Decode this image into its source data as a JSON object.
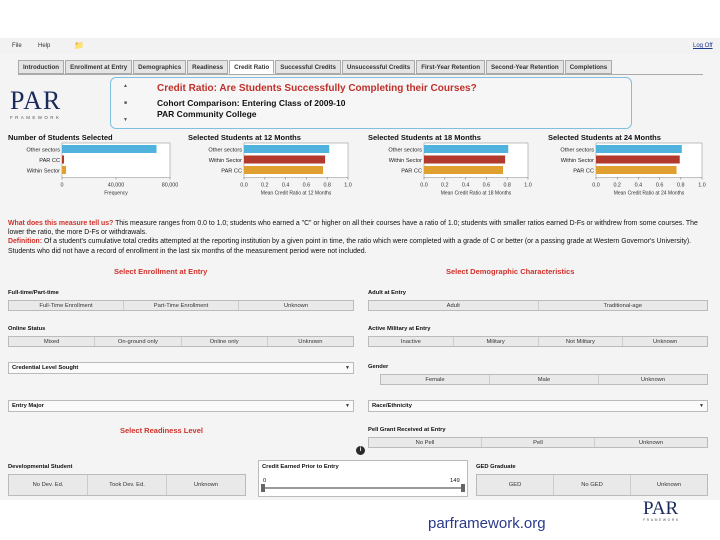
{
  "menu": {
    "file": "File",
    "help": "Help",
    "folder_icon": "folder-icon",
    "logoff": "Log Off"
  },
  "tabs": [
    {
      "label": "Introduction",
      "active": false
    },
    {
      "label": "Enrollment at Entry",
      "active": false
    },
    {
      "label": "Demographics",
      "active": false
    },
    {
      "label": "Readiness",
      "active": false
    },
    {
      "label": "Credit Ratio",
      "active": true
    },
    {
      "label": "Successful Credits",
      "active": false
    },
    {
      "label": "Unsuccessful Credits",
      "active": false
    },
    {
      "label": "First-Year Retention",
      "active": false
    },
    {
      "label": "Second-Year Retention",
      "active": false
    },
    {
      "label": "Completions",
      "active": false
    }
  ],
  "logo": {
    "text": "PAR",
    "subtext": "FRAMEWORK"
  },
  "header": {
    "title": "Credit Ratio: Are Students Successfully Completing their Courses?",
    "cohort": "Cohort Comparison: Entering Class of 2009-10",
    "institution": "PAR Community College"
  },
  "colors": {
    "blue": "#4fb3dd",
    "red": "#b23a2c",
    "orange": "#e0a030"
  },
  "chart_data": [
    {
      "type": "bar",
      "title": "Number of Students Selected",
      "categories": [
        "Other sectors",
        "PAR CC",
        "Within Sector"
      ],
      "values": [
        70000,
        1500,
        3000
      ],
      "colors": [
        "#4fb3dd",
        "#b23a2c",
        "#e0a030"
      ],
      "xlabel": "Frequency",
      "xticks": [
        "0",
        "40,000",
        "80,000"
      ],
      "xlim": [
        0,
        80000
      ]
    },
    {
      "type": "bar",
      "title": "Selected Students at 12 Months",
      "categories": [
        "Other sectors",
        "Within Sector",
        "PAR CC"
      ],
      "values": [
        0.82,
        0.78,
        0.76
      ],
      "colors": [
        "#4fb3dd",
        "#b23a2c",
        "#e0a030"
      ],
      "xlabel": "Mean Credit Ratio at 12 Months",
      "xticks": [
        "0.0",
        "0.2",
        "0.4",
        "0.6",
        "0.8",
        "1.0"
      ],
      "xlim": [
        0,
        1
      ]
    },
    {
      "type": "bar",
      "title": "Selected Students at 18 Months",
      "categories": [
        "Other sectors",
        "Within Sector",
        "PAR CC"
      ],
      "values": [
        0.81,
        0.78,
        0.76
      ],
      "colors": [
        "#4fb3dd",
        "#b23a2c",
        "#e0a030"
      ],
      "xlabel": "Mean Credit Ratio at 18 Months",
      "xticks": [
        "0.0",
        "0.2",
        "0.4",
        "0.6",
        "0.8",
        "1.0"
      ],
      "xlim": [
        0,
        1
      ]
    },
    {
      "type": "bar",
      "title": "Selected Students at 24 Months",
      "categories": [
        "Other sectors",
        "Within Sector",
        "PAR CC"
      ],
      "values": [
        0.81,
        0.79,
        0.76
      ],
      "colors": [
        "#4fb3dd",
        "#b23a2c",
        "#e0a030"
      ],
      "xlabel": "Mean Credit Ratio at 24 Months",
      "xticks": [
        "0.0",
        "0.2",
        "0.4",
        "0.6",
        "0.8",
        "1.0"
      ],
      "xlim": [
        0,
        1
      ]
    }
  ],
  "description": {
    "q_label": "What does this measure tell us?",
    "q_text": " This measure ranges from 0.0 to 1.0; students who earned a \"C\" or higher on all their courses have a ratio of 1.0; students with smaller ratios earned D-Fs or withdrew from some courses. The lower the ratio, the more D-Fs or withdrawals.",
    "def_label": "Definition:",
    "def_text": " Of a student's cumulative total credits attempted at the reporting institution by a given point in time, the ratio which were completed with a grade of C or better (or a passing grade at Western Governor's University). Students who did not have a record of enrollment in the last six months of the measurement period were not included."
  },
  "sections": {
    "enrollment": "Select Enrollment at Entry",
    "demographic": "Select Demographic Characteristics",
    "readiness": "Select Readiness Level"
  },
  "filters": {
    "fulltime": {
      "label": "Full-time/Part-time",
      "options": [
        "Full-Time Enrollment",
        "Part-Time Enrollment",
        "Unknown"
      ]
    },
    "adult": {
      "label": "Adult at Entry",
      "options": [
        "Adult",
        "Traditional-age"
      ]
    },
    "online": {
      "label": "Online Status",
      "options": [
        "Mixed",
        "On-ground only",
        "Online only",
        "Unknown"
      ]
    },
    "military": {
      "label": "Active Military at Entry",
      "options": [
        "Inactive",
        "Military",
        "Not Military",
        "Unknown"
      ]
    },
    "credential": {
      "label": "Credential Level Sought"
    },
    "gender": {
      "label": "Gender",
      "options": [
        "Female",
        "Male",
        "Unknown"
      ]
    },
    "major": {
      "label": "Entry Major"
    },
    "race": {
      "label": "Race/Ethnicity"
    },
    "pell": {
      "label": "Pell Grant Received at Entry",
      "options": [
        "No Pell",
        "Pell",
        "Unknown"
      ]
    },
    "devstudent": {
      "label": "Developmental Student",
      "options": [
        "No Dev. Ed.",
        "Took Dev. Ed.",
        "Unknown"
      ]
    },
    "credit_earned": {
      "label": "Credit Earned Prior to Entry",
      "min": "0",
      "max": "149"
    },
    "ged": {
      "label": "GED Graduate",
      "options": [
        "GED",
        "No GED",
        "Unknown"
      ]
    }
  },
  "footer": {
    "url": "parframework.org",
    "logo": "PAR",
    "logo_sub": "FRAMEWORK"
  }
}
